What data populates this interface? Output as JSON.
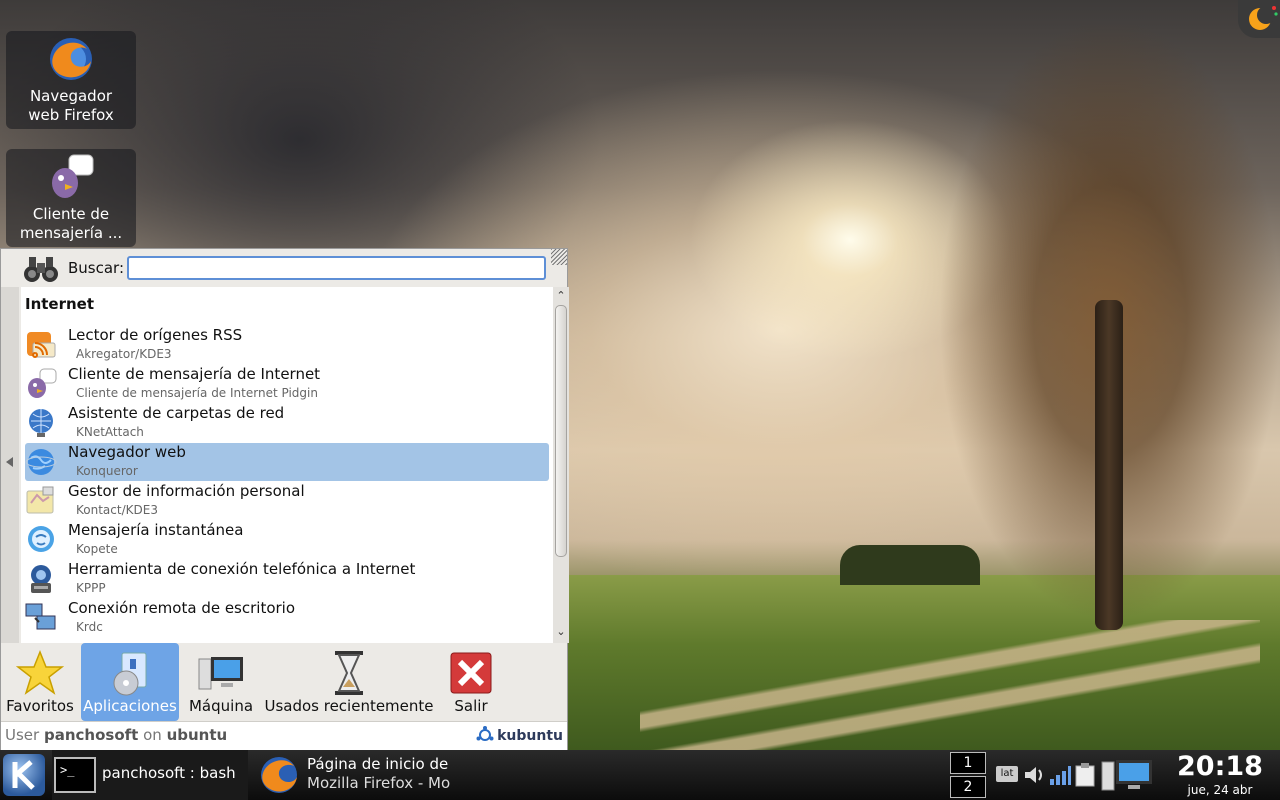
{
  "desktop": {
    "icons": [
      {
        "label": "Navegador web Firefox"
      },
      {
        "label": "Cliente de mensajería ..."
      }
    ]
  },
  "menu": {
    "search_label": "Buscar:",
    "search_value": "",
    "category": "Internet",
    "items": [
      {
        "title": "Lector de orígenes RSS",
        "subtitle": "Akregator/KDE3",
        "icon": "rss-icon"
      },
      {
        "title": "Cliente de mensajería de Internet",
        "subtitle": "Cliente de mensajería de Internet Pidgin",
        "icon": "pidgin-icon"
      },
      {
        "title": "Asistente de carpetas de red",
        "subtitle": "KNetAttach",
        "icon": "network-folder-icon"
      },
      {
        "title": "Navegador web",
        "subtitle": "Konqueror",
        "icon": "globe-icon",
        "selected": true
      },
      {
        "title": "Gestor de información personal",
        "subtitle": "Kontact/KDE3",
        "icon": "kontact-icon"
      },
      {
        "title": "Mensajería instantánea",
        "subtitle": "Kopete",
        "icon": "kopete-icon"
      },
      {
        "title": "Herramienta de conexión telefónica a Internet",
        "subtitle": "KPPP",
        "icon": "kppp-icon"
      },
      {
        "title": "Conexión remota de escritorio",
        "subtitle": "Krdc",
        "icon": "remote-desktop-icon"
      }
    ],
    "tabs": [
      {
        "label": "Favoritos",
        "icon": "star-icon"
      },
      {
        "label": "Aplicaciones",
        "icon": "applications-icon",
        "active": true
      },
      {
        "label": "Máquina",
        "icon": "computer-icon"
      },
      {
        "label": "Usados recientemente",
        "icon": "hourglass-icon"
      },
      {
        "label": "Salir",
        "icon": "exit-icon"
      }
    ],
    "user_prefix": "User",
    "user_name": "panchosoft",
    "user_on": "on",
    "host": "ubuntu",
    "brand": "kubuntu"
  },
  "taskbar": {
    "tasks": [
      {
        "label": "panchosoft : bash",
        "icon": "terminal-icon"
      },
      {
        "label_line1": "Página de inicio de",
        "label_line2": "Mozilla Firefox - Mo",
        "icon": "firefox-icon"
      }
    ],
    "pager": [
      "1",
      "2"
    ],
    "tray_kbd": "lat",
    "clock_time": "20:18",
    "clock_date": "jue, 24 abr"
  },
  "colors": {
    "selection": "#a3c4e6",
    "active_tab": "#6ea4e6",
    "search_border": "#5e8fd6"
  }
}
